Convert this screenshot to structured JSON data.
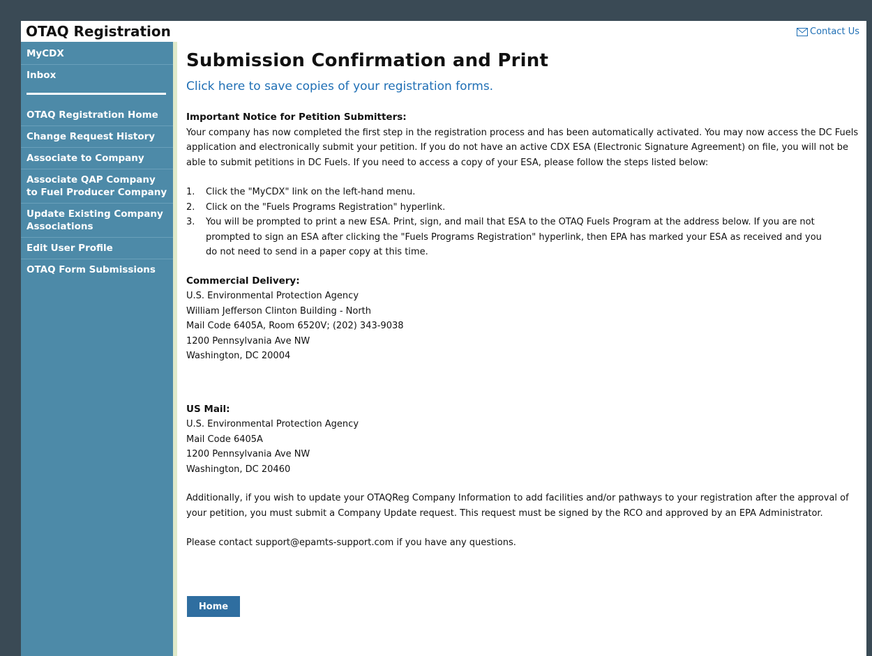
{
  "header": {
    "app_title": "OTAQ Registration",
    "contact_label": "Contact Us"
  },
  "sidebar": {
    "top_items": [
      "MyCDX",
      "Inbox"
    ],
    "items": [
      "OTAQ Registration Home",
      "Change Request History",
      "Associate to Company",
      "Associate QAP Company to Fuel Producer Company",
      "Update Existing Company Associations",
      "Edit User Profile",
      "OTAQ Form Submissions"
    ]
  },
  "main": {
    "title": "Submission Confirmation and Print",
    "save_link": "Click here to save copies of your registration forms.",
    "notice_heading": "Important Notice for Petition Submitters:",
    "notice_text": "Your company has now completed the first step in the registration process and has been automatically activated. You may now access the DC Fuels application and electronically submit your petition. If you do not have an active CDX ESA (Electronic Signature Agreement) on file, you will not be able to submit petitions in DC Fuels. If you need to access a copy of your ESA, please follow the steps listed below:",
    "steps": [
      {
        "num": "1.",
        "text": "Click the \"MyCDX\" link on the left-hand menu."
      },
      {
        "num": "2.",
        "text": "Click on the \"Fuels Programs Registration\" hyperlink."
      },
      {
        "num": "3.",
        "text": "You will be prompted to print a new ESA. Print, sign, and mail that ESA to the OTAQ Fuels Program at the address below. If you are not prompted to sign an ESA after clicking the \"Fuels Programs Registration\" hyperlink, then EPA has marked your ESA as received and you do not need to send in a paper copy at this time."
      }
    ],
    "commercial": {
      "heading": "Commercial Delivery:",
      "lines": [
        "U.S. Environmental Protection Agency",
        "William Jefferson Clinton Building - North",
        "Mail Code 6405A, Room 6520V; (202) 343-9038",
        "1200 Pennsylvania Ave NW",
        "Washington, DC 20004"
      ]
    },
    "usmail": {
      "heading": "US Mail:",
      "lines": [
        "U.S. Environmental Protection Agency",
        "Mail Code 6405A",
        "1200 Pennsylvania Ave NW",
        "Washington, DC 20460"
      ]
    },
    "additional_text": "Additionally, if you wish to update your OTAQReg Company Information to add facilities and/or pathways to your registration after the approval of your petition, you must submit a Company Update request. This request must be signed by the RCO and approved by an EPA Administrator.",
    "contact_text": "Please contact support@epamts-support.com if you have any questions.",
    "home_button": "Home"
  },
  "colors": {
    "sidebar_bg": "#4d8aa8",
    "link": "#1f6fb5",
    "button_bg": "#2f6ea0"
  }
}
